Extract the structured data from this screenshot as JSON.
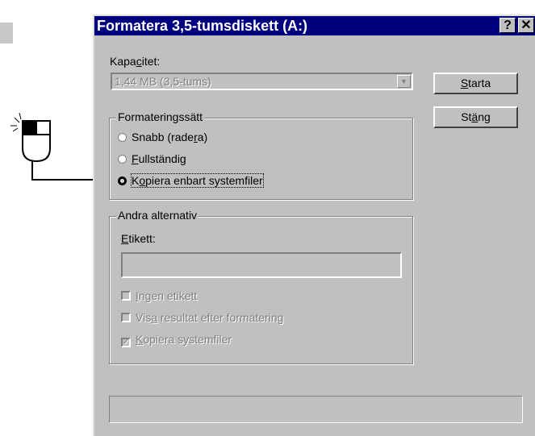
{
  "dialog": {
    "title": "Formatera 3,5-tumsdiskett (A:)",
    "help_btn": "?",
    "close_btn": "✕"
  },
  "capacity": {
    "label_pre": "Kapa",
    "label_ul": "c",
    "label_post": "itet:",
    "value": "1,44 MB (3,5-tums)"
  },
  "buttons": {
    "start_ul": "S",
    "start_rest": "tarta",
    "close_pre": "St",
    "close_ul": "ä",
    "close_post": "ng"
  },
  "format_type": {
    "legend": "Formateringssätt",
    "options": [
      {
        "pre": "Snabb (rade",
        "ul": "r",
        "post": "a)",
        "selected": false
      },
      {
        "pre": "",
        "ul": "F",
        "post": "ullständig",
        "selected": false
      },
      {
        "pre": "K",
        "ul": "o",
        "post": "piera enbart systemfiler",
        "selected": true
      }
    ]
  },
  "other_options": {
    "legend": "Andra alternativ",
    "label_ul": "E",
    "label_rest": "tikett:",
    "label_value": "",
    "checkboxes": [
      {
        "pre": "",
        "ul": "I",
        "post": "ngen etikett",
        "checked": false
      },
      {
        "pre": "Vis",
        "ul": "a",
        "post": " resultat efter formatering",
        "checked": false
      },
      {
        "pre": "",
        "ul": "K",
        "post": "opiera systemfiler",
        "checked": true
      }
    ]
  },
  "colors": {
    "title_bar": "#00007f",
    "dialog_bg": "#c0c0c0"
  }
}
